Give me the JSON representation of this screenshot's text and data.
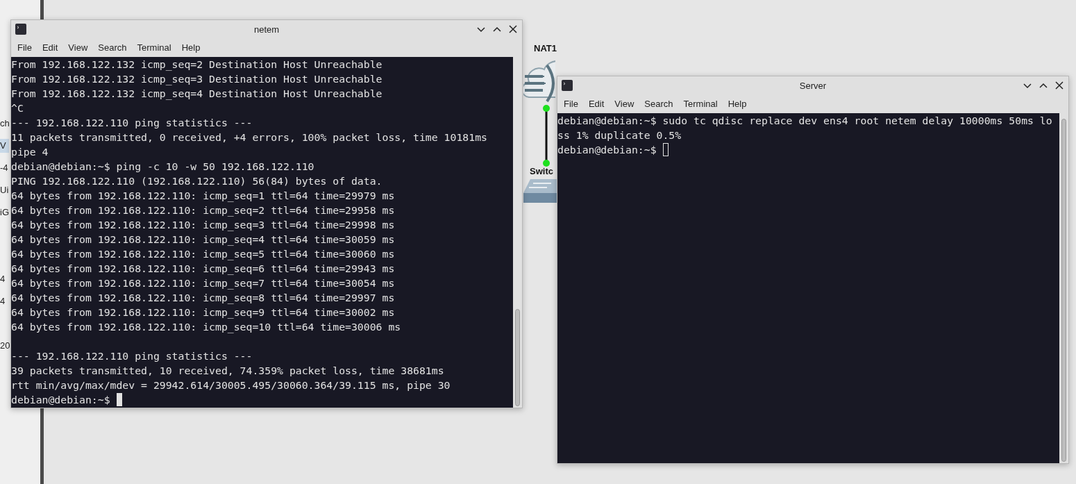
{
  "canvas": {
    "side_fragments": [
      "ch",
      "V",
      "-4",
      "Ui",
      "iG",
      "4",
      "4",
      "20"
    ],
    "nodes": [
      {
        "kind": "cloud",
        "label": "NAT1"
      },
      {
        "kind": "switch",
        "label": "Switc"
      }
    ]
  },
  "windows": [
    {
      "title": "netem",
      "focused": true,
      "scrolled_back": true,
      "menu": [
        "File",
        "Edit",
        "View",
        "Search",
        "Terminal",
        "Help"
      ],
      "blocks": [
        [
          "From 192.168.122.132 icmp_seq=2 Destination Host Unreachable",
          "From 192.168.122.132 icmp_seq=3 Destination Host Unreachable",
          "From 192.168.122.132 icmp_seq=4 Destination Host Unreachable",
          "^C",
          "--- 192.168.122.110 ping statistics ---",
          "11 packets transmitted, 0 received, +4 errors, 100% packet loss, time 10181ms",
          "pipe 4",
          "debian@debian:~$ ping -c 10 -w 50 192.168.122.110",
          "PING 192.168.122.110 (192.168.122.110) 56(84) bytes of data.",
          "64 bytes from 192.168.122.110: icmp_seq=1 ttl=64 time=29979 ms",
          "64 bytes from 192.168.122.110: icmp_seq=2 ttl=64 time=29958 ms",
          "64 bytes from 192.168.122.110: icmp_seq=3 ttl=64 time=29998 ms",
          "64 bytes from 192.168.122.110: icmp_seq=4 ttl=64 time=30059 ms",
          "64 bytes from 192.168.122.110: icmp_seq=5 ttl=64 time=30060 ms",
          "64 bytes from 192.168.122.110: icmp_seq=6 ttl=64 time=29943 ms",
          "64 bytes from 192.168.122.110: icmp_seq=7 ttl=64 time=30054 ms",
          "64 bytes from 192.168.122.110: icmp_seq=8 ttl=64 time=29997 ms",
          "64 bytes from 192.168.122.110: icmp_seq=9 ttl=64 time=30002 ms",
          "64 bytes from 192.168.122.110: icmp_seq=10 ttl=64 time=30006 ms"
        ],
        [
          "--- 192.168.122.110 ping statistics ---",
          "39 packets transmitted, 10 received, 74.359% packet loss, time 38681ms",
          "rtt min/avg/max/mdev = 29942.614/30005.495/30060.364/39.115 ms, pipe 30",
          "debian@debian:~$"
        ]
      ]
    },
    {
      "title": "Server",
      "focused": false,
      "scrolled_back": false,
      "menu": [
        "File",
        "Edit",
        "View",
        "Search",
        "Terminal",
        "Help"
      ],
      "blocks": [
        [
          "debian@debian:~$ sudo tc qdisc replace dev ens4 root netem delay 10000ms 50ms lo",
          "ss 1% duplicate 0.5%",
          "debian@debian:~$"
        ]
      ]
    }
  ]
}
